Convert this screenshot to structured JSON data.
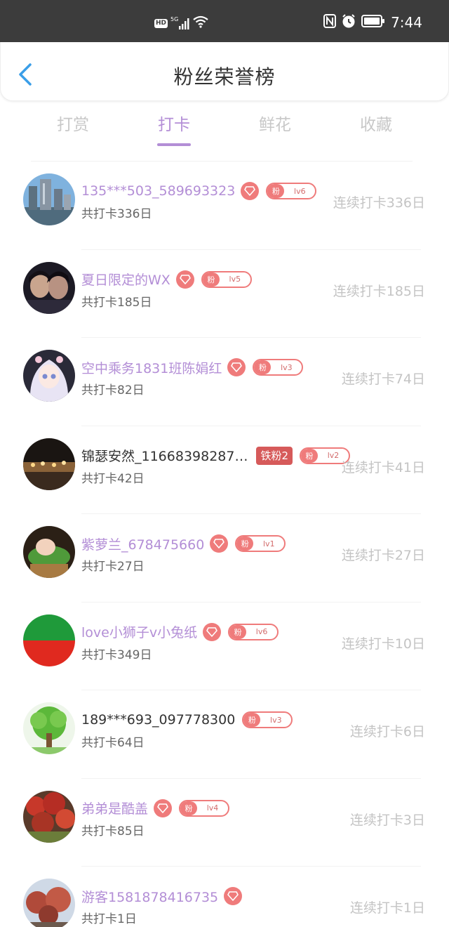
{
  "status_bar": {
    "hd": "HD",
    "network": "5G",
    "time": "7:44"
  },
  "header": {
    "title": "粉丝荣誉榜"
  },
  "tabs": [
    {
      "label": "打赏",
      "active": false
    },
    {
      "label": "打卡",
      "active": true
    },
    {
      "label": "鲜花",
      "active": false
    },
    {
      "label": "收藏",
      "active": false
    }
  ],
  "fan_badge_label": "粉",
  "rows": [
    {
      "name": "135***503_589693323",
      "highlight": true,
      "vip": true,
      "level": "lv6",
      "iron": "",
      "total": "共打卡336日",
      "streak": "连续打卡336日"
    },
    {
      "name": "夏日限定的WX",
      "highlight": true,
      "vip": true,
      "level": "lv5",
      "iron": "",
      "total": "共打卡185日",
      "streak": "连续打卡185日"
    },
    {
      "name": "空中乘务1831班陈娟红",
      "highlight": true,
      "vip": true,
      "level": "lv3",
      "iron": "",
      "total": "共打卡82日",
      "streak": "连续打卡74日"
    },
    {
      "name": "锦瑟安然_11668398287…",
      "highlight": false,
      "vip": false,
      "level": "lv2",
      "iron": "铁粉2",
      "total": "共打卡42日",
      "streak": "连续打卡41日"
    },
    {
      "name": "紫萝兰_678475660",
      "highlight": true,
      "vip": true,
      "level": "lv1",
      "iron": "",
      "total": "共打卡27日",
      "streak": "连续打卡27日"
    },
    {
      "name": "love小狮子v小兔纸",
      "highlight": true,
      "vip": true,
      "level": "lv6",
      "iron": "",
      "total": "共打卡349日",
      "streak": "连续打卡10日"
    },
    {
      "name": "189***693_097778300",
      "highlight": false,
      "vip": false,
      "level": "lv3",
      "iron": "",
      "total": "共打卡64日",
      "streak": "连续打卡6日"
    },
    {
      "name": "弟弟是酷盖",
      "highlight": true,
      "vip": true,
      "level": "lv4",
      "iron": "",
      "total": "共打卡85日",
      "streak": "连续打卡3日"
    },
    {
      "name": "游客1581878416735",
      "highlight": true,
      "vip": true,
      "level": "",
      "iron": "",
      "total": "共打卡1日",
      "streak": "连续打卡1日"
    }
  ],
  "colors": {
    "accent": "#b38ed6",
    "badge": "#ef7b7b",
    "iron": "#d65a5a",
    "muted": "#c4c4c4"
  }
}
